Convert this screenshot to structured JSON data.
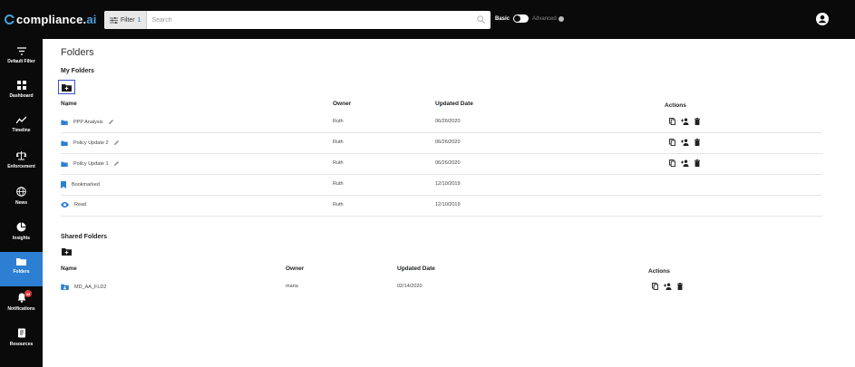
{
  "app": {
    "logo_prefix": "compliance.",
    "logo_suffix": "ai",
    "accent": "#2d7fd3"
  },
  "search": {
    "filter_label": "Filter",
    "filter_count": "1",
    "placeholder": "Search",
    "mode_basic": "Basic",
    "mode_advanced": "Advanced"
  },
  "sidebar": {
    "items": [
      {
        "label": "Default Filter",
        "icon": "filter-icon"
      },
      {
        "label": "Dashboard",
        "icon": "dashboard-icon"
      },
      {
        "label": "Timeline",
        "icon": "timeline-icon"
      },
      {
        "label": "Enforcement",
        "icon": "enforcement-icon"
      },
      {
        "label": "News",
        "icon": "globe-icon"
      },
      {
        "label": "Insights",
        "icon": "pie-chart-icon"
      },
      {
        "label": "Folders",
        "icon": "folder-icon",
        "active": true
      },
      {
        "label": "Notifications",
        "icon": "bell-icon",
        "badge": "42"
      },
      {
        "label": "Resources",
        "icon": "book-icon"
      }
    ]
  },
  "page": {
    "title": "Folders",
    "my_folders": {
      "title": "My Folders",
      "columns": {
        "name": "Name",
        "owner": "Owner",
        "updated": "Updated Date",
        "actions": "Actions"
      },
      "rows": [
        {
          "name": "PPP Analysis",
          "owner": "Ruth",
          "updated": "06/26/2020",
          "icon": "folder-icon",
          "editable": true,
          "actions": true
        },
        {
          "name": "Policy Update 2",
          "owner": "Ruth",
          "updated": "06/26/2020",
          "icon": "folder-icon",
          "editable": true,
          "actions": true
        },
        {
          "name": "Policy Update 1",
          "owner": "Ruth",
          "updated": "06/26/2020",
          "icon": "folder-icon",
          "editable": true,
          "actions": true
        },
        {
          "name": "Bookmarked",
          "owner": "Ruth",
          "updated": "12/10/2019",
          "icon": "bookmark-icon",
          "editable": false,
          "actions": false
        },
        {
          "name": "Read",
          "owner": "Ruth",
          "updated": "12/10/2019",
          "icon": "eye-icon",
          "editable": false,
          "actions": false
        }
      ]
    },
    "shared_folders": {
      "title": "Shared Folders",
      "columns": {
        "name": "Name",
        "owner": "Owner",
        "updated": "Updated Date",
        "actions": "Actions"
      },
      "rows": [
        {
          "name": "MD_AA_FLD2",
          "owner": "maria",
          "updated": "02/14/2020",
          "icon": "shared-folder-icon"
        }
      ]
    }
  }
}
